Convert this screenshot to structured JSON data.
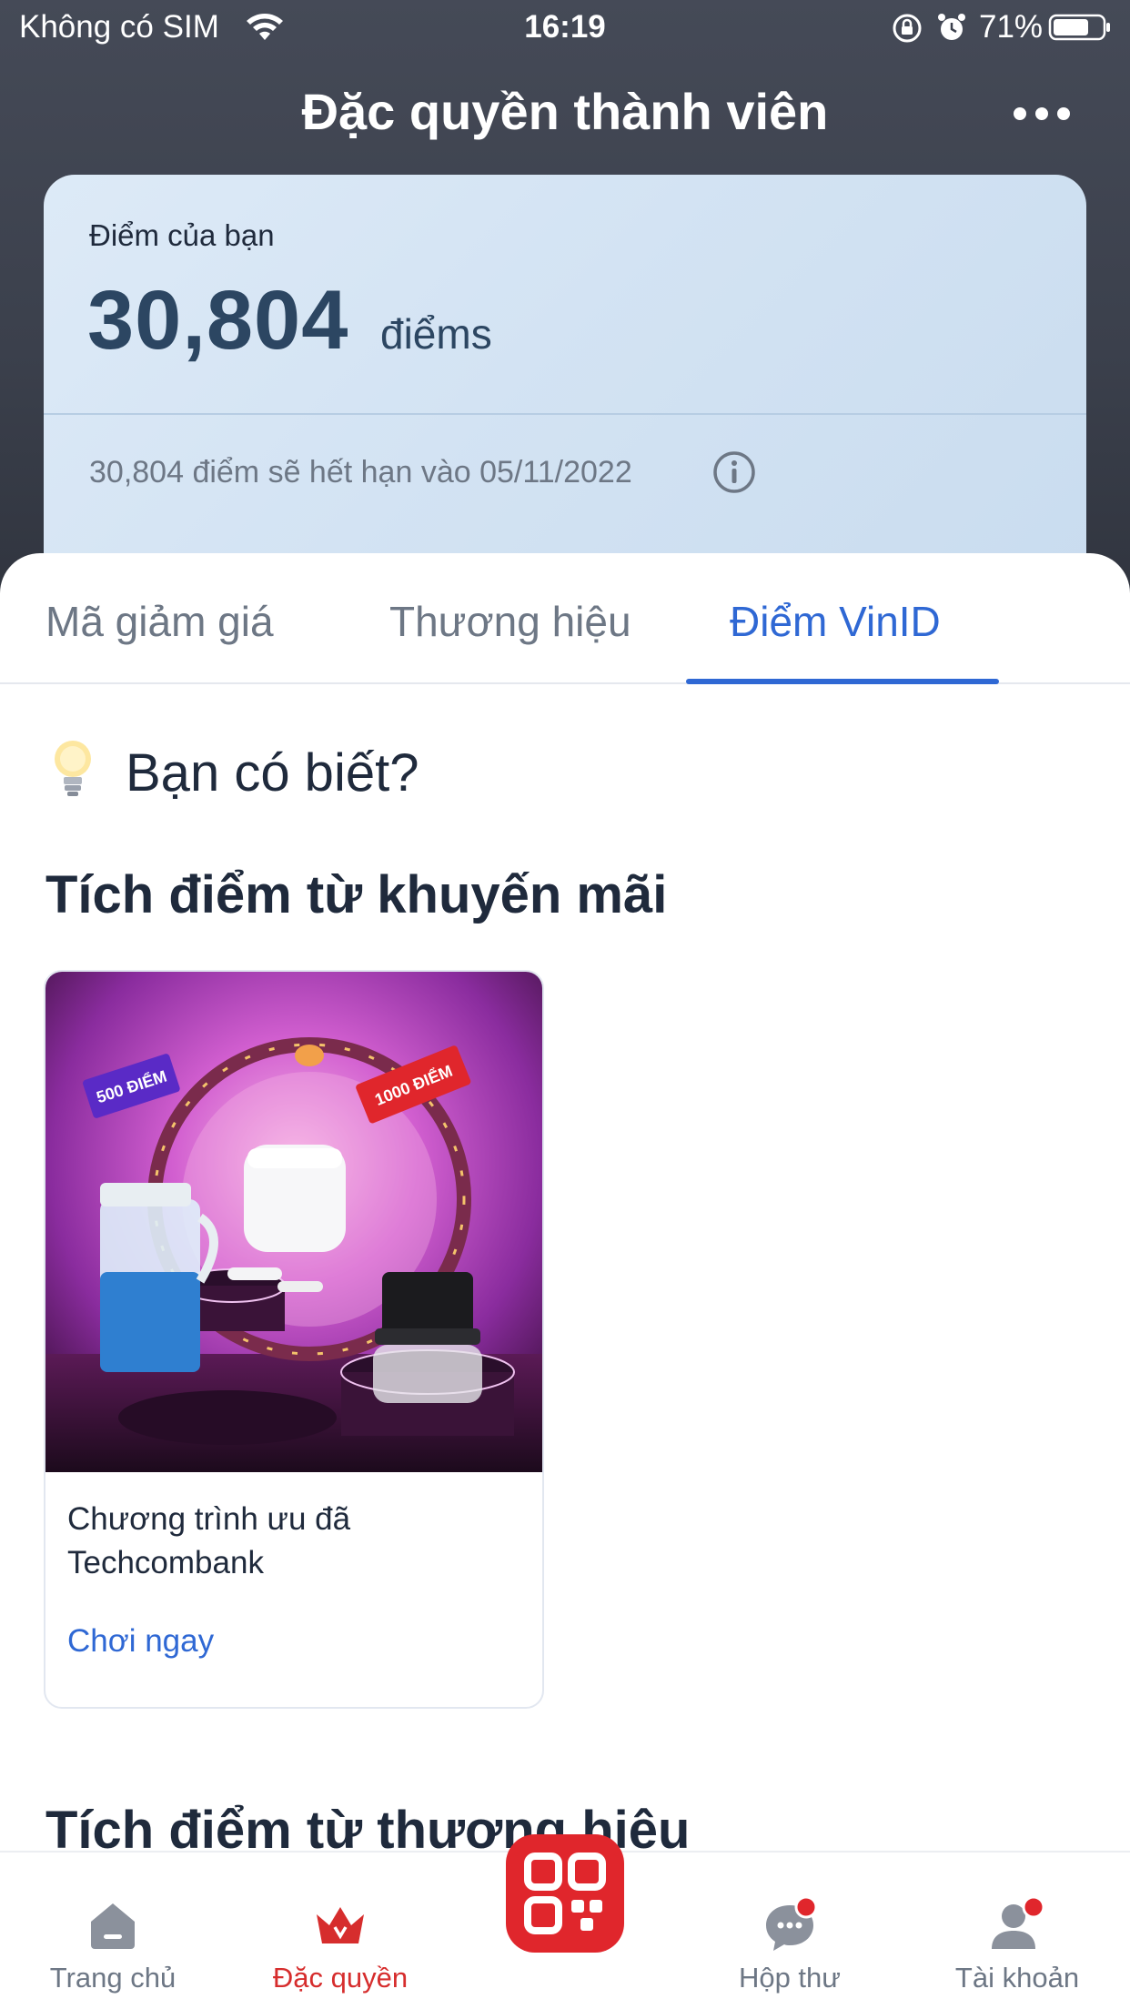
{
  "status_bar": {
    "carrier": "Không có SIM",
    "time": "16:19",
    "battery": "71%"
  },
  "header": {
    "title": "Đặc quyền thành viên"
  },
  "points_card": {
    "label": "Điểm của bạn",
    "value": "30,804",
    "unit": "điểms",
    "expiry": "30,804 điểm sẽ hết hạn vào 05/11/2022"
  },
  "tabs": [
    {
      "label": "Mã giảm giá",
      "active": false
    },
    {
      "label": "Thương hiệu",
      "active": false
    },
    {
      "label": "Điểm VinID",
      "active": true
    }
  ],
  "tip": {
    "heading": "Bạn có biết?"
  },
  "sections": {
    "promotions_heading": "Tích điểm từ khuyến mãi",
    "brands_heading": "Tích điểm từ thương hiệu"
  },
  "promo_card": {
    "title": "Chương trình ưu đã Techcombank",
    "action": "Chơi ngay",
    "image_labels": {
      "left_ticket": "500 ĐIỂM",
      "right_ticket": "1000 ĐIỂM"
    }
  },
  "bottom_nav": [
    {
      "label": "Trang chủ",
      "icon": "home-icon",
      "active": false
    },
    {
      "label": "Đặc quyền",
      "icon": "crown-icon",
      "active": true
    },
    {
      "label": "",
      "icon": "qr-code-icon",
      "active": false
    },
    {
      "label": "Hộp thư",
      "icon": "chat-bubble-icon",
      "active": false,
      "badge": true
    },
    {
      "label": "Tài khoản",
      "icon": "user-icon",
      "active": false,
      "badge": true
    }
  ],
  "colors": {
    "accent_blue": "#2f68d4",
    "brand_red": "#e0262c",
    "header_dark": "#3b404c"
  }
}
